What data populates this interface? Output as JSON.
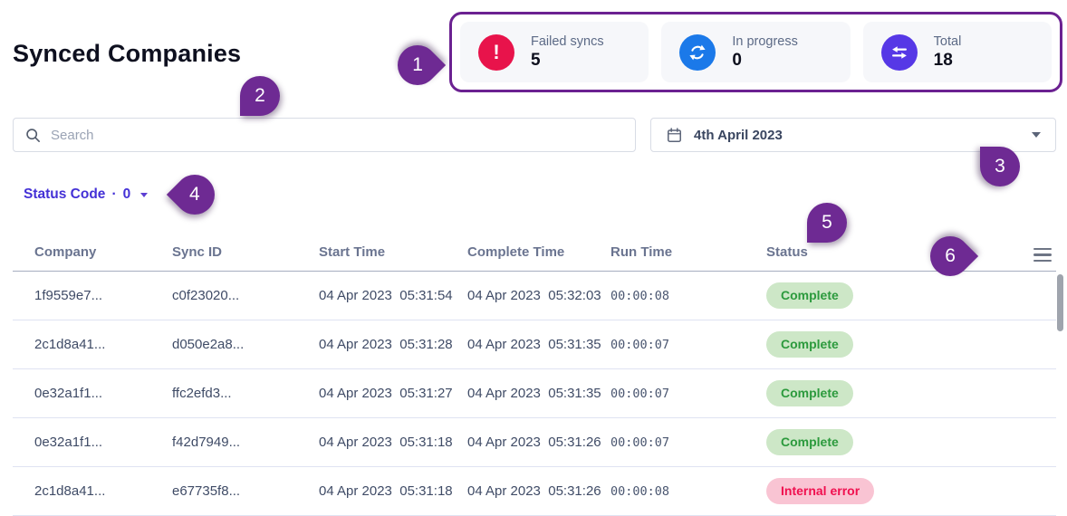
{
  "page": {
    "title": "Synced Companies"
  },
  "stats": {
    "cards": [
      {
        "label": "Failed syncs",
        "value": "5",
        "icon": "alert-icon",
        "color": "#e8134b"
      },
      {
        "label": "In progress",
        "value": "0",
        "icon": "sync-icon",
        "color": "#1b79e9"
      },
      {
        "label": "Total",
        "value": "18",
        "icon": "transfer-icon",
        "color": "#5638e6"
      }
    ]
  },
  "search": {
    "placeholder": "Search"
  },
  "date_picker": {
    "value": "4th April 2023"
  },
  "filters": {
    "status_code": {
      "label": "Status Code",
      "separator": "·",
      "count": "0"
    }
  },
  "table": {
    "columns": [
      "Company",
      "Sync ID",
      "Start Time",
      "Complete Time",
      "Run Time",
      "Status"
    ],
    "rows": [
      {
        "company": "1f9559e7...",
        "sync_id": "c0f23020...",
        "start_time": "04 Apr 2023  05:31:54",
        "complete_time": "04 Apr 2023  05:32:03",
        "run_time": "00:00:08",
        "status": "Complete",
        "status_type": "success"
      },
      {
        "company": "2c1d8a41...",
        "sync_id": "d050e2a8...",
        "start_time": "04 Apr 2023  05:31:28",
        "complete_time": "04 Apr 2023  05:31:35",
        "run_time": "00:00:07",
        "status": "Complete",
        "status_type": "success"
      },
      {
        "company": "0e32a1f1...",
        "sync_id": "ffc2efd3...",
        "start_time": "04 Apr 2023  05:31:27",
        "complete_time": "04 Apr 2023  05:31:35",
        "run_time": "00:00:07",
        "status": "Complete",
        "status_type": "success"
      },
      {
        "company": "0e32a1f1...",
        "sync_id": "f42d7949...",
        "start_time": "04 Apr 2023  05:31:18",
        "complete_time": "04 Apr 2023  05:31:26",
        "run_time": "00:00:07",
        "status": "Complete",
        "status_type": "success"
      },
      {
        "company": "2c1d8a41...",
        "sync_id": "e67735f8...",
        "start_time": "04 Apr 2023  05:31:18",
        "complete_time": "04 Apr 2023  05:31:26",
        "run_time": "00:00:08",
        "status": "Internal error",
        "status_type": "error"
      }
    ]
  },
  "annotations": {
    "color": "#6b2191",
    "callouts": [
      {
        "n": "1"
      },
      {
        "n": "2"
      },
      {
        "n": "3"
      },
      {
        "n": "4"
      },
      {
        "n": "5"
      },
      {
        "n": "6"
      }
    ]
  },
  "status_colors": {
    "success_bg": "#cde7c7",
    "success_text": "#2c9a3d",
    "error_bg": "#f9c4d3",
    "error_text": "#f0104f"
  }
}
